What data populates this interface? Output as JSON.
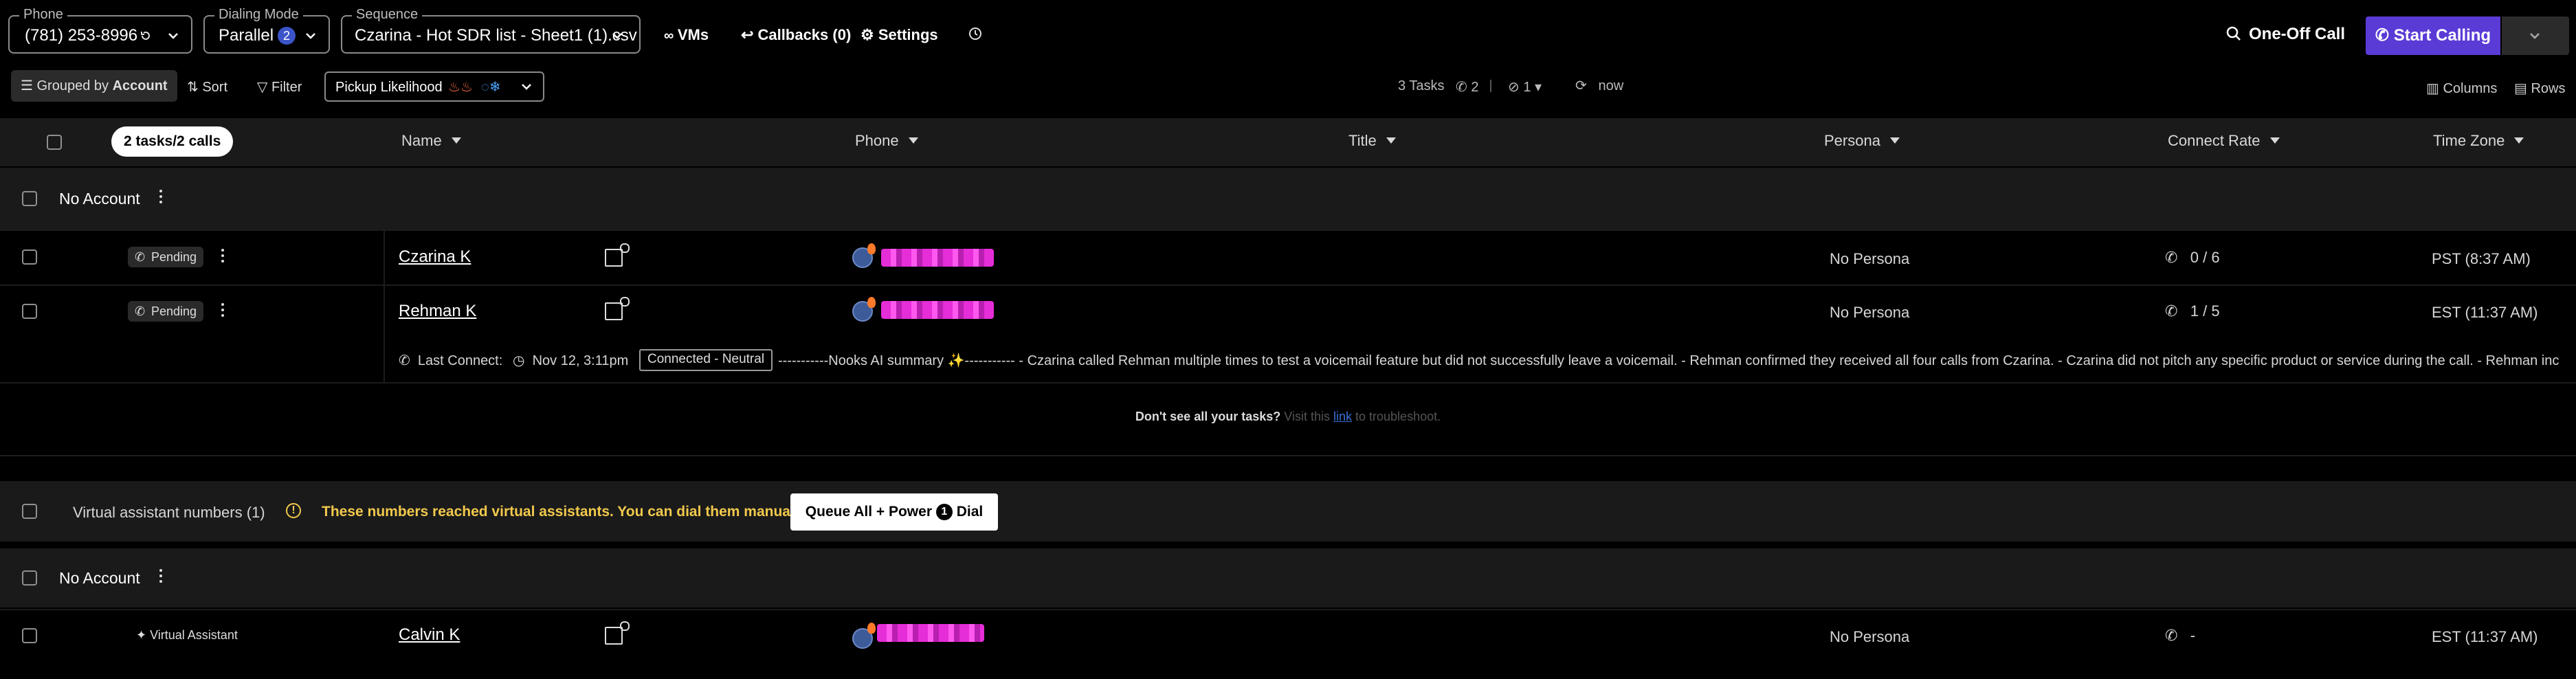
{
  "toolbar": {
    "phone": {
      "legend": "Phone",
      "value": "(781) 253-8996"
    },
    "dialing_mode": {
      "legend": "Dialing Mode",
      "value": "Parallel",
      "count": "2"
    },
    "sequence": {
      "legend": "Sequence",
      "value": "Czarina - Hot SDR list - Sheet1 (1).csv"
    },
    "vms_label": "VMs",
    "callbacks_label": "Callbacks (0)",
    "settings_label": "Settings",
    "one_off_call": "One-Off Call",
    "start_calling": "Start Calling"
  },
  "subbar": {
    "grouped_by_prefix": "Grouped by",
    "grouped_by_value": "Account",
    "sort_label": "Sort",
    "filter_label": "Filter",
    "pickup_label": "Pickup Likelihood",
    "tasks_count": "3 Tasks",
    "calls_count": "2",
    "hidden_count": "1",
    "refresh_time": "now",
    "columns_label": "Columns",
    "rows_label": "Rows"
  },
  "table": {
    "summary_pill": "2 tasks/2 calls",
    "headers": {
      "name": "Name",
      "phone": "Phone",
      "title": "Title",
      "persona": "Persona",
      "connect_rate": "Connect Rate",
      "time_zone": "Time Zone"
    },
    "group1_label": "No Account",
    "rows": [
      {
        "status": "Pending",
        "name": "Czarina K",
        "persona": "No Persona",
        "connect_rate": "0 / 6",
        "time_zone": "PST (8:37 AM)"
      },
      {
        "status": "Pending",
        "name": "Rehman K",
        "persona": "No Persona",
        "connect_rate": "1 / 5",
        "time_zone": "EST (11:37 AM)"
      }
    ],
    "last_connect": {
      "label": "Last Connect:",
      "date": "Nov 12, 3:11pm",
      "outcome": "Connected - Neutral",
      "summary": "-----------Nooks AI summary ✨----------- - Czarina called Rehman multiple times to test a voicemail feature but did not successfully leave a voicemail. - Rehman confirmed they received all four calls from Czarina. - Czarina did not pitch any specific product or service during the call. - Rehman inc"
    },
    "missing_tasks": {
      "prefix": "Don't see all your tasks?",
      "mid": "Visit this",
      "link": "link",
      "suffix": "to troubleshoot."
    }
  },
  "va_section": {
    "label": "Virtual assistant numbers (1)",
    "warning": "These numbers reached virtual assistants. You can dial them manually.",
    "queue_button_prefix": "Queue All + Power",
    "queue_button_num": "1",
    "queue_button_suffix": "Dial",
    "group_label": "No Account",
    "row": {
      "status": "Virtual Assistant",
      "name": "Calvin K",
      "persona": "No Persona",
      "connect_rate": "-",
      "time_zone": "EST (11:37 AM)"
    }
  },
  "colors": {
    "accent": "#5b3bd6",
    "warning": "#f2c94c",
    "link": "#3b6fd8"
  }
}
